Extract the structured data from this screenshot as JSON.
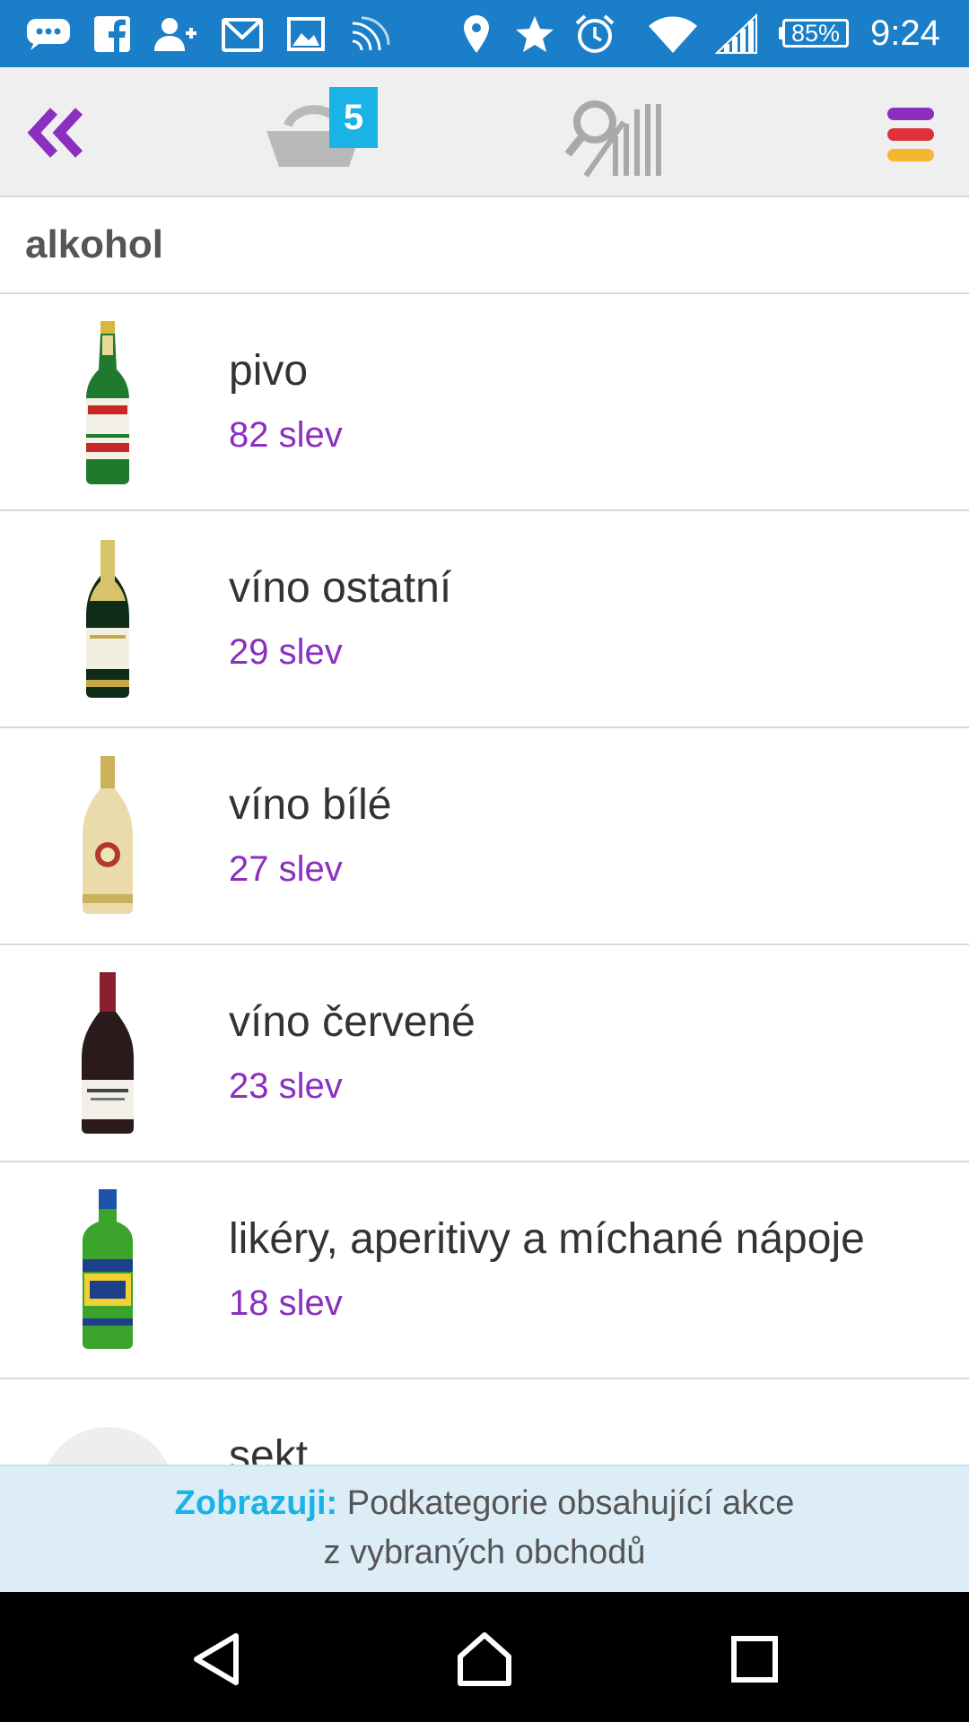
{
  "status_bar": {
    "battery_percent": "85%",
    "time": "9:24",
    "icons": [
      "chat-icon",
      "facebook-icon",
      "add-contact-icon",
      "gmail-icon",
      "image-icon",
      "cast-icon",
      "location-icon",
      "star-icon",
      "alarm-icon",
      "wifi-icon",
      "signal-icon",
      "battery-icon"
    ]
  },
  "toolbar": {
    "back_icon": "double-chevron-left-icon",
    "basket_icon": "basket-icon",
    "basket_count": "5",
    "scan_icon": "search-barcode-icon",
    "menu_icon": "menu-icon",
    "menu_colors": [
      "#8a2fc0",
      "#e0303a",
      "#f5b731"
    ]
  },
  "category": {
    "title": "alkohol"
  },
  "items": [
    {
      "name": "pivo",
      "count": "82 slev",
      "thumb": "beer-bottle"
    },
    {
      "name": "víno ostatní",
      "count": "29 slev",
      "thumb": "sparkling-wine-bottle"
    },
    {
      "name": "víno bílé",
      "count": "27 slev",
      "thumb": "white-wine-bottle"
    },
    {
      "name": "víno červené",
      "count": "23 slev",
      "thumb": "red-wine-bottle"
    },
    {
      "name": "likéry, aperitivy a míchané nápoje",
      "count": "18 slev",
      "thumb": "liqueur-bottle"
    },
    {
      "name": "sekt",
      "count": "",
      "thumb": "placeholder"
    }
  ],
  "banner": {
    "label": "Zobrazuji:",
    "text": "Podkategorie obsahující akce",
    "text_line2": "z vybraných obchodů"
  },
  "colors": {
    "status_bar": "#1a7ec8",
    "accent_purple": "#8a2fc0",
    "accent_blue": "#1ab3e6",
    "banner_bg": "#ddedf8"
  },
  "nav": {
    "back_icon": "back-triangle-icon",
    "home_icon": "home-icon",
    "recents_icon": "recents-square-icon"
  }
}
